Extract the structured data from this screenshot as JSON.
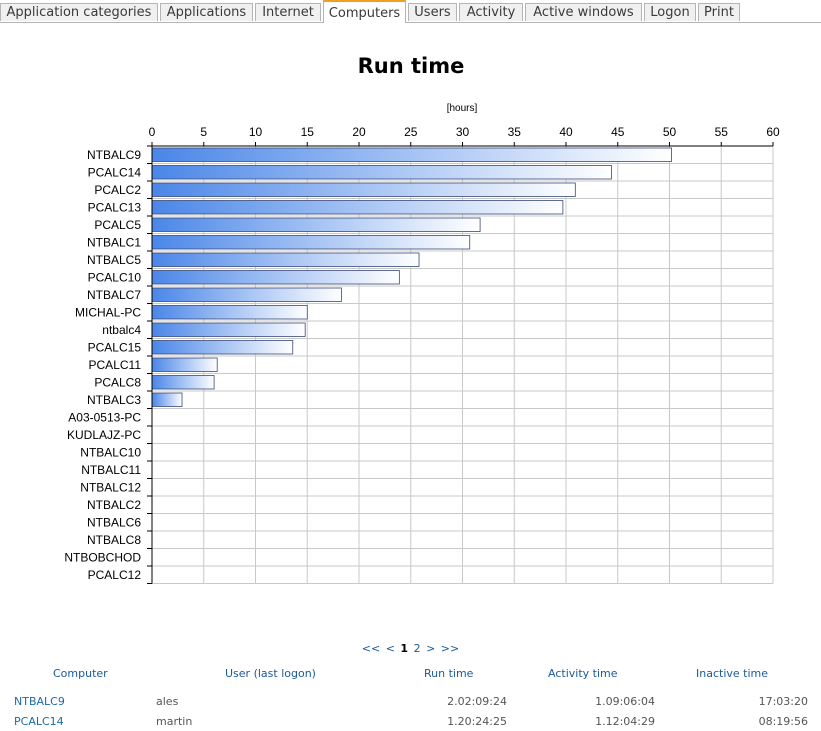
{
  "tabs": [
    {
      "label": "Application categories",
      "active": false
    },
    {
      "label": "Applications",
      "active": false
    },
    {
      "label": "Internet",
      "active": false
    },
    {
      "label": "Computers",
      "active": true
    },
    {
      "label": "Users",
      "active": false
    },
    {
      "label": "Activity",
      "active": false
    },
    {
      "label": "Active windows",
      "active": false
    },
    {
      "label": "Logon",
      "active": false
    },
    {
      "label": "Print",
      "active": false
    }
  ],
  "chart_data": {
    "type": "bar",
    "orientation": "horizontal",
    "title": "Run time",
    "unit_label": "[hours]",
    "xlim": [
      0,
      60
    ],
    "x_ticks": [
      0,
      5,
      10,
      15,
      20,
      25,
      30,
      35,
      40,
      45,
      50,
      55,
      60
    ],
    "grid": true,
    "bar_gradient": [
      "#4a86e8",
      "#ffffff"
    ],
    "categories": [
      "NTBALC9",
      "PCALC14",
      "PCALC2",
      "PCALC13",
      "PCALC5",
      "NTBALC1",
      "NTBALC5",
      "PCALC10",
      "NTBALC7",
      "MICHAL-PC",
      "ntbalc4",
      "PCALC15",
      "PCALC11",
      "PCALC8",
      "NTBALC3",
      "A03-0513-PC",
      "KUDLAJZ-PC",
      "NTBALC10",
      "NTBALC11",
      "NTBALC12",
      "NTBALC2",
      "NTBALC6",
      "NTBALC8",
      "NTBOBCHOD",
      "PCALC12"
    ],
    "values": [
      50.2,
      44.4,
      40.9,
      39.7,
      31.7,
      30.7,
      25.8,
      23.9,
      18.3,
      15.0,
      14.8,
      13.6,
      6.3,
      6.0,
      2.9,
      0,
      0,
      0,
      0,
      0,
      0,
      0,
      0,
      0,
      0
    ]
  },
  "pager": {
    "first": "<<",
    "prev": "<",
    "current": "1",
    "next_page": "2",
    "next": ">",
    "last": ">>"
  },
  "table": {
    "headers": {
      "computer": "Computer",
      "user": "User (last logon)",
      "run_time": "Run time",
      "activity_time": "Activity time",
      "inactive_time": "Inactive time"
    },
    "rows": [
      {
        "computer": "NTBALC9",
        "user": "ales",
        "run_time": "2.02:09:24",
        "activity_time": "1.09:06:04",
        "inactive_time": "17:03:20"
      },
      {
        "computer": "PCALC14",
        "user": "martin",
        "run_time": "1.20:24:25",
        "activity_time": "1.12:04:29",
        "inactive_time": "08:19:56"
      }
    ]
  }
}
